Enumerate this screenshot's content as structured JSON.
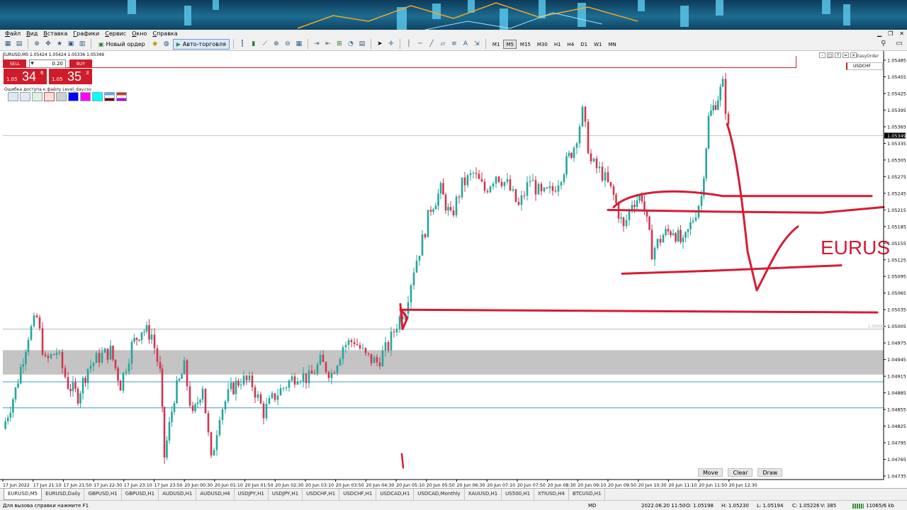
{
  "menu": [
    "Файл",
    "Вид",
    "Вставка",
    "Графики",
    "Сервис",
    "Окно",
    "Справка"
  ],
  "toolbar": {
    "new_order": "Новый ордер",
    "auto_trading": "Авто-торговля",
    "timeframes": [
      "M1",
      "M5",
      "M15",
      "M30",
      "H1",
      "H4",
      "D1",
      "W1",
      "MN"
    ],
    "active_timeframe": "M5"
  },
  "chart": {
    "header": "EURUSD,M5  1.05424 1.05424 1.05336 1.05349",
    "current_price": "1.05349",
    "level_label": "1.05000",
    "easy_order": "EasyOrder",
    "symbol_box": "USDCHF",
    "annotation_text": "EURUS",
    "buttons": {
      "move": "Move",
      "clear": "Clear",
      "draw": "Draw"
    },
    "price_labels": [
      "1.05485",
      "1.05455",
      "1.05425",
      "1.05395",
      "1.05365",
      "1.05335",
      "1.05305",
      "1.05275",
      "1.05245",
      "1.05215",
      "1.05185",
      "1.05155",
      "1.05125",
      "1.05095",
      "1.05065",
      "1.05035",
      "1.05005",
      "1.04975",
      "1.04945",
      "1.04915",
      "1.04885",
      "1.04855",
      "1.04825",
      "1.04795",
      "1.04765",
      "1.04735"
    ],
    "time_labels": [
      "17 Jun 2022",
      "17 Jun 21:10",
      "17 Jun 21:50",
      "17 Jun 22:30",
      "17 Jun 23:10",
      "17 Jun 23:50",
      "20 Jun 00:30",
      "20 Jun 01:10",
      "20 Jun 01:50",
      "20 Jun 02:30",
      "20 Jun 03:10",
      "20 Jun 03:50",
      "20 Jun 04:30",
      "20 Jun 05:10",
      "20 Jun 05:50",
      "20 Jun 06:30",
      "20 Jun 07:10",
      "20 Jun 07:50",
      "20 Jun 08:30",
      "20 Jun 09:10",
      "20 Jun 09:50",
      "20 Jun 10:30",
      "20 Jun 11:10",
      "20 Jun 11:50",
      "20 Jun 12:30"
    ]
  },
  "trade_panel": {
    "sell": "SELL",
    "buy": "BUY",
    "lot": "0.20",
    "sell_prefix": "1.05",
    "sell_big": "34",
    "sell_sup": "6",
    "buy_prefix": "1.05",
    "buy_big": "35",
    "buy_sup": "3",
    "error": "Ошибка доступа к файлу Level_day.csv"
  },
  "tabs": [
    "EURUSD,M5",
    "EURUSD,Daily",
    "GBPUSD,H1",
    "GBPUSD,H1",
    "AUDUSD,H1",
    "AUDUSD,H4",
    "USDJPY,H1",
    "USDJPY,H1",
    "USDCHF,H1",
    "USDCHF,H1",
    "USDCAD,H1",
    "USDCAD,Monthly",
    "XAUUSD,H1",
    "US500,H1",
    "XTIUSD,H4",
    "BTCUSD,H1"
  ],
  "active_tab": 0,
  "status": {
    "help": "Для вызова справки нажмите F1",
    "mode": "MD",
    "datetime": "2022.06.20 11:50",
    "open": "O: 1.05198",
    "high": "H: 1.05230",
    "low": "L: 1.05194",
    "close": "C: 1.05226",
    "volume": "V: 385",
    "traffic": "11065/6 kb"
  },
  "colors": {
    "bull": "#26a69a",
    "bear": "#d0364f",
    "annotation": "#d51c35",
    "blue_level": "#3a9bd0",
    "zone": "#c4c4c4"
  }
}
